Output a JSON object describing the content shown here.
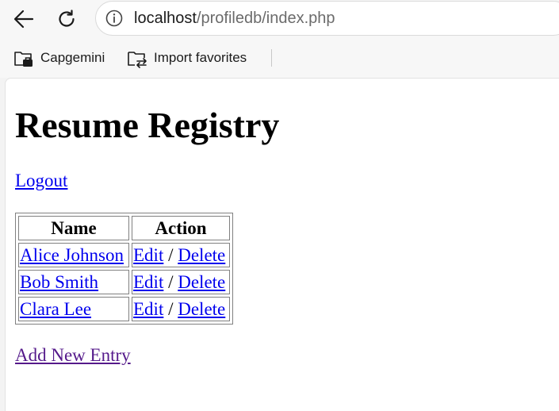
{
  "browser": {
    "url_host": "localhost",
    "url_path": "/profiledb/index.php",
    "icons": {
      "back": "arrow-left-icon",
      "reload": "reload-icon",
      "info": "info-circle-icon"
    }
  },
  "bookmarks": [
    {
      "label": "Capgemini",
      "icon": "briefcase-icon"
    },
    {
      "label": "Import favorites",
      "icon": "import-folder-icon"
    }
  ],
  "page": {
    "title": "Resume Registry",
    "logout_label": "Logout",
    "table": {
      "headers": [
        "Name",
        "Action"
      ],
      "rows": [
        {
          "name": "Alice Johnson",
          "edit": "Edit",
          "separator": "/",
          "delete": "Delete"
        },
        {
          "name": "Bob Smith",
          "edit": "Edit",
          "separator": "/",
          "delete": "Delete"
        },
        {
          "name": "Clara Lee",
          "edit": "Edit",
          "separator": "/",
          "delete": "Delete"
        }
      ]
    },
    "add_entry_label": "Add New Entry"
  },
  "colors": {
    "link": "#0000ee",
    "visited_link": "#551a8b"
  }
}
